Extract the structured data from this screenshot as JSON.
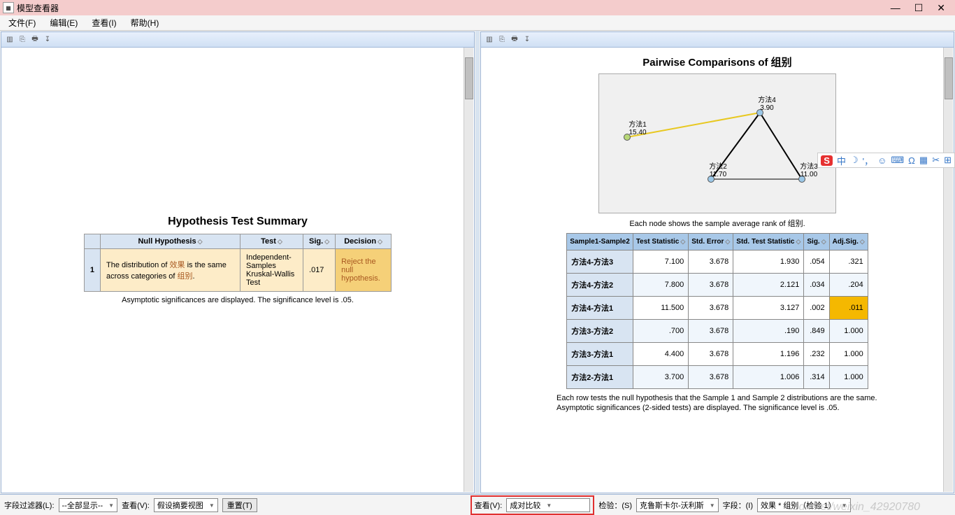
{
  "window": {
    "title": "模型查看器"
  },
  "menu": {
    "file": "文件(F)",
    "edit": "编辑(E)",
    "view": "查看(I)",
    "help": "帮助(H)"
  },
  "left": {
    "hyp_title": "Hypothesis Test Summary",
    "headers": {
      "idx": "",
      "null": "Null Hypothesis",
      "test": "Test",
      "sig": "Sig.",
      "decision": "Decision"
    },
    "row": {
      "idx": "1",
      "null_a": "The distribution of ",
      "null_var": "效果",
      "null_b": " is the same across categories of ",
      "null_grp": "组别",
      "null_c": ".",
      "test": "Independent-Samples Kruskal-Wallis Test",
      "sig": ".017",
      "decision": "Reject the null hypothesis."
    },
    "note": "Asymptotic significances are displayed.  The significance level is .05."
  },
  "right": {
    "title": "Pairwise Comparisons of 组别",
    "nodes": {
      "n1": {
        "label": "方法1",
        "val": "15.40"
      },
      "n2": {
        "label": "方法2",
        "val": "11.70"
      },
      "n3": {
        "label": "方法3",
        "val": "11.00"
      },
      "n4": {
        "label": "方法4",
        "val": "3.90"
      }
    },
    "chart_note": "Each node shows the sample average rank of 组别.",
    "headers": {
      "pair": "Sample1-Sample2",
      "stat": "Test Statistic",
      "se": "Std. Error",
      "std": "Std. Test Statistic",
      "sig": "Sig.",
      "adj": "Adj.Sig."
    },
    "rows": [
      {
        "pair": "方法4-方法3",
        "stat": "7.100",
        "se": "3.678",
        "std": "1.930",
        "sig": ".054",
        "adj": ".321"
      },
      {
        "pair": "方法4-方法2",
        "stat": "7.800",
        "se": "3.678",
        "std": "2.121",
        "sig": ".034",
        "adj": ".204"
      },
      {
        "pair": "方法4-方法1",
        "stat": "11.500",
        "se": "3.678",
        "std": "3.127",
        "sig": ".002",
        "adj": ".011"
      },
      {
        "pair": "方法3-方法2",
        "stat": ".700",
        "se": "3.678",
        "std": ".190",
        "sig": ".849",
        "adj": "1.000"
      },
      {
        "pair": "方法3-方法1",
        "stat": "4.400",
        "se": "3.678",
        "std": "1.196",
        "sig": ".232",
        "adj": "1.000"
      },
      {
        "pair": "方法2-方法1",
        "stat": "3.700",
        "se": "3.678",
        "std": "1.006",
        "sig": ".314",
        "adj": "1.000"
      }
    ],
    "foot1": "Each row tests the null hypothesis that the Sample 1 and Sample 2 distributions are the same.",
    "foot2": "Asymptotic significances (2-sided tests) are displayed. The significance level is .05."
  },
  "footer_left": {
    "filter_lbl": "字段过滤器(L):",
    "filter_val": "--全部显示--",
    "view_lbl": "查看(V):",
    "view_val": "假设摘要视图",
    "reset": "重置(T)"
  },
  "footer_right": {
    "view_lbl": "查看(V):",
    "view_val": "成对比较",
    "test_lbl": "检验：(S)",
    "test_val": "克鲁斯卡尔-沃利斯",
    "field_lbl": "字段：(I)",
    "field_val": "效果 * 组别（检验 1）"
  },
  "ime": {
    "s": "S",
    "zh": "中",
    "moon": "☽",
    "comma": "'，",
    "smile": "☺",
    "kb": "⌨",
    "omega": "Ω",
    "box": "▦",
    "crop": "✂",
    "grid": "⊞"
  },
  "watermark": "csdn.net/weixin_42920780",
  "chart_data": {
    "type": "scatter",
    "title": "Pairwise Comparisons of 组别",
    "series": [
      {
        "name": "方法1",
        "value": 15.4
      },
      {
        "name": "方法2",
        "value": 11.7
      },
      {
        "name": "方法3",
        "value": 11.0
      },
      {
        "name": "方法4",
        "value": 3.9
      }
    ],
    "edges": [
      [
        "方法1",
        "方法4",
        "yellow"
      ],
      [
        "方法4",
        "方法2",
        "black"
      ],
      [
        "方法4",
        "方法3",
        "black"
      ],
      [
        "方法2",
        "方法3",
        "black"
      ]
    ]
  }
}
